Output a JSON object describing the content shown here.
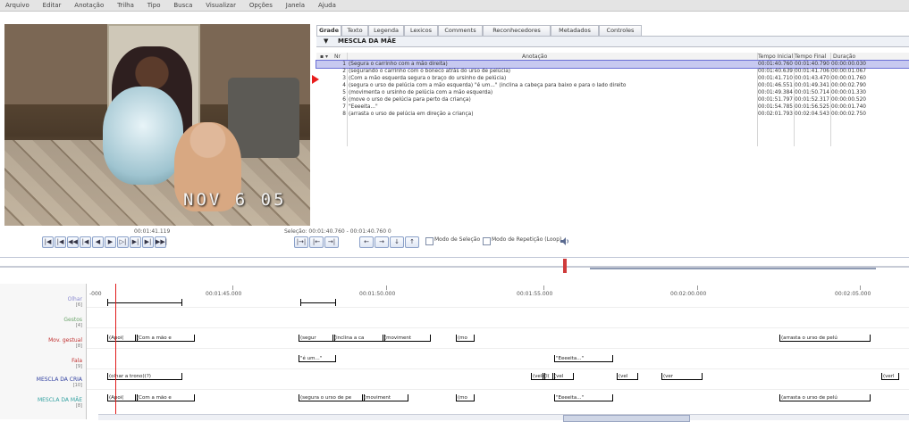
{
  "menubar": [
    "Arquivo",
    "Editar",
    "Anotação",
    "Trilha",
    "Tipo",
    "Busca",
    "Visualizar",
    "Opções",
    "Janela",
    "Ajuda"
  ],
  "video": {
    "timestamp_overlay": "NOV   6 05"
  },
  "player": {
    "current_time": "00:01:41.119",
    "selection_info": "Seleção: 00:01:40.760 - 00:01:40.760  0",
    "controls": [
      "|◀",
      "|◀",
      "◀◀",
      "|◀",
      "◀",
      "▶",
      "▷|",
      "▶|",
      "▶|",
      "▶▶|"
    ],
    "nav_controls": [
      "|→|",
      "|←",
      "→|"
    ],
    "arrow_controls": [
      "←",
      "→",
      "↓",
      "↑"
    ],
    "selection_mode_label": "Modo de Seleção",
    "loop_mode_label": "Modo de Repetição (Loop)",
    "volume_icon": "speaker-icon"
  },
  "tabs": [
    "Grade",
    "Texto",
    "Legenda",
    "Lexicos",
    "Comments",
    "Reconhecedores",
    "Metadados",
    "Controles"
  ],
  "active_tab": "Grade",
  "tier_selector": "MESCLA DA MÃE",
  "table": {
    "columns": [
      "Nr",
      "Anotação",
      "Tempo Inicial",
      "Tempo Final",
      "Duração"
    ],
    "rows": [
      {
        "nr": "1",
        "annotation": "(Segura o carrinho com a mão direita)",
        "start": "00:01:40.760",
        "end": "00:01:40.790",
        "dur": "00:00:00.030",
        "selected": true
      },
      {
        "nr": "2",
        "annotation": "(segurando o carrinho com o boneco atrás do urso de pelúcia)",
        "start": "00:01:40.639",
        "end": "00:01:41.706",
        "dur": "00:00:01.067",
        "selected": false
      },
      {
        "nr": "3",
        "annotation": "(Com a mão esquerda segura o braço do ursinho de pelúcia)",
        "start": "00:01:41.710",
        "end": "00:01:43.470",
        "dur": "00:00:01.760",
        "selected": false
      },
      {
        "nr": "4",
        "annotation": "(segura o urso de pelúcia com a mão esquerda) \"é um...\" (inclina a cabeça para baixo e para o lado direito",
        "start": "00:01:46.551",
        "end": "00:01:49.341",
        "dur": "00:00:02.790",
        "selected": false
      },
      {
        "nr": "5",
        "annotation": "(movimenta o ursinho de pelúcia com a mão esquerda)",
        "start": "00:01:49.384",
        "end": "00:01:50.714",
        "dur": "00:00:01.330",
        "selected": false
      },
      {
        "nr": "6",
        "annotation": "(move o urso de pelúcia para perto da criança)",
        "start": "00:01:51.797",
        "end": "00:01:52.317",
        "dur": "00:00:00.520",
        "selected": false
      },
      {
        "nr": "7",
        "annotation": "\"Eeeeita...\"",
        "start": "00:01:54.785",
        "end": "00:01:56.525",
        "dur": "00:00:01.740",
        "selected": false
      },
      {
        "nr": "8",
        "annotation": "(arrasta o urso de pelúcia em direção a criança)",
        "start": "00:02:01.793",
        "end": "00:02:04.543",
        "dur": "00:00:02.750",
        "selected": false
      }
    ]
  },
  "timeline": {
    "ruler_labels": [
      "-000",
      "00:01:45.000",
      "00:01:50.000",
      "00:01:55.000",
      "00:02:00.000",
      "00:02:05.000"
    ],
    "tiers": [
      {
        "name": "Olhar",
        "sub": "[6]",
        "color": "#8a8ad0"
      },
      {
        "name": "Gestos",
        "sub": "[4]",
        "color": "#6aa36a"
      },
      {
        "name": "Mov. gestual",
        "sub": "[8]",
        "color": "#c03030"
      },
      {
        "name": "Fala",
        "sub": "[9]",
        "color": "#c03030"
      },
      {
        "name": "MESCLA DA CRIA",
        "sub": "[10]",
        "color": "#3040a0"
      },
      {
        "name": "MESCLA DA MÃE",
        "sub": "[8]",
        "color": "#30a0a0"
      }
    ],
    "segments": {
      "mov": [
        "(Apoi(",
        "(Com a mão e",
        "(segur",
        "(inclina a ca",
        "(moviment",
        "(mo",
        "(arrasta o urso de pelú"
      ],
      "fala": [
        "\"é um...\"",
        "\"Eeeeita...\""
      ],
      "cria": [
        "(olhar a trono)(?)",
        "(velo",
        "(l(",
        "(vel",
        "(vel",
        "(ver",
        "(verl"
      ],
      "mae": [
        "(Apoi(",
        "(Com a mão e",
        "(segura o urso de pe",
        "(moviment",
        "(mo",
        "\"Eeeeita...\"",
        "(arrasta o urso de pelú"
      ]
    }
  }
}
